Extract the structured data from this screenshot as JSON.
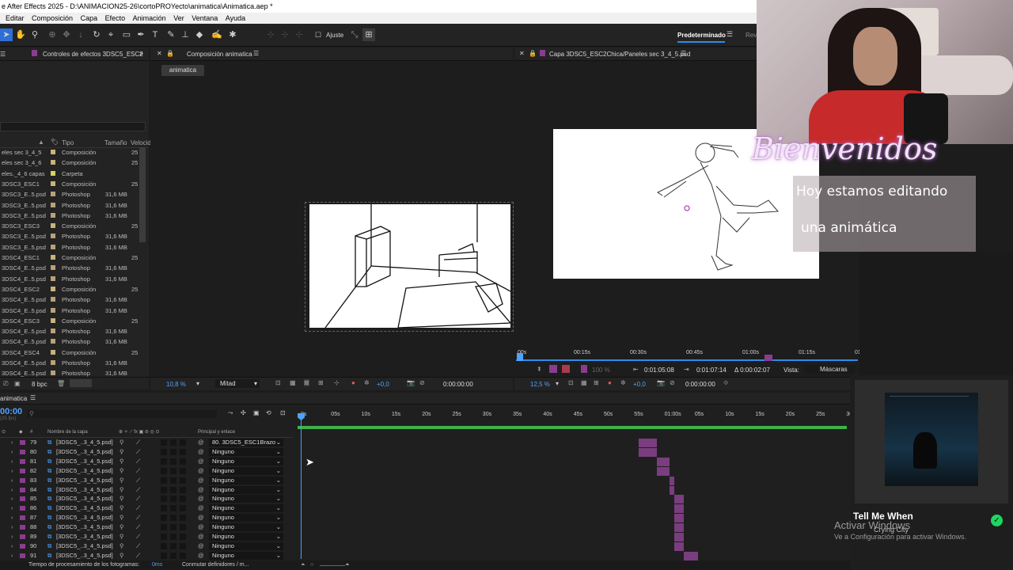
{
  "window": {
    "title": "e After Effects 2025 - D:\\ANIMACION25-26\\cortoPROYecto\\animatica\\Animatica.aep *"
  },
  "menu": [
    "Editar",
    "Composición",
    "Capa",
    "Efecto",
    "Animación",
    "Ver",
    "Ventana",
    "Ayuda"
  ],
  "toolbar": {
    "snap_label": "Ajuste",
    "workspace": "Predeterminado",
    "workspace_next": "Revi"
  },
  "project_panel": {
    "tab_effects": "Controles de efectos 3DSC5_ESC2",
    "columns": {
      "tipo": "Tipo",
      "tamano": "Tamaño",
      "velocidad": "Velocid"
    },
    "bpc": "8 bpc",
    "rows": [
      {
        "name": "eles sec 3_4_5",
        "type": "Composición",
        "size": "",
        "fps": "25",
        "color": "#c9b37a"
      },
      {
        "name": "eles sec 3_4_6",
        "type": "Composición",
        "size": "",
        "fps": "25",
        "color": "#c9b37a"
      },
      {
        "name": "eles._4_6 capas",
        "type": "Carpeta",
        "size": "",
        "fps": "",
        "color": "#d6d35a"
      },
      {
        "name": "3DSC3_ESC1",
        "type": "Composición",
        "size": "",
        "fps": "25",
        "color": "#c9b37a"
      },
      {
        "name": "3DSC3_E..5.psd",
        "type": "Photoshop",
        "size": "31,6 MB",
        "fps": "",
        "color": "#b8a27a"
      },
      {
        "name": "3DSC3_E..5.psd",
        "type": "Photoshop",
        "size": "31,6 MB",
        "fps": "",
        "color": "#b8a27a"
      },
      {
        "name": "3DSC3_E..5.psd",
        "type": "Photoshop",
        "size": "31,6 MB",
        "fps": "",
        "color": "#b8a27a"
      },
      {
        "name": "3DSC3_ESC3",
        "type": "Composición",
        "size": "",
        "fps": "25",
        "color": "#c9b37a"
      },
      {
        "name": "3DSC3_E..5.psd",
        "type": "Photoshop",
        "size": "31,6 MB",
        "fps": "",
        "color": "#b8a27a"
      },
      {
        "name": "3DSC3_E..5.psd",
        "type": "Photoshop",
        "size": "31,6 MB",
        "fps": "",
        "color": "#b8a27a"
      },
      {
        "name": "3DSC4_ESC1",
        "type": "Composición",
        "size": "",
        "fps": "25",
        "color": "#c9b37a"
      },
      {
        "name": "3DSC4_E..5.psd",
        "type": "Photoshop",
        "size": "31,6 MB",
        "fps": "",
        "color": "#b8a27a"
      },
      {
        "name": "3DSC4_E..5.psd",
        "type": "Photoshop",
        "size": "31,6 MB",
        "fps": "",
        "color": "#b8a27a"
      },
      {
        "name": "3DSC4_ESC2",
        "type": "Composición",
        "size": "",
        "fps": "25",
        "color": "#c9b37a"
      },
      {
        "name": "3DSC4_E..5.psd",
        "type": "Photoshop",
        "size": "31,6 MB",
        "fps": "",
        "color": "#b8a27a"
      },
      {
        "name": "3DSC4_E..5.psd",
        "type": "Photoshop",
        "size": "31,6 MB",
        "fps": "",
        "color": "#b8a27a"
      },
      {
        "name": "3DSC4_ESC3",
        "type": "Composición",
        "size": "",
        "fps": "25",
        "color": "#c9b37a"
      },
      {
        "name": "3DSC4_E..5.psd",
        "type": "Photoshop",
        "size": "31,6 MB",
        "fps": "",
        "color": "#b8a27a"
      },
      {
        "name": "3DSC4_E..5.psd",
        "type": "Photoshop",
        "size": "31,6 MB",
        "fps": "",
        "color": "#b8a27a"
      },
      {
        "name": "3DSC4_ESC4",
        "type": "Composición",
        "size": "",
        "fps": "25",
        "color": "#c9b37a"
      },
      {
        "name": "3DSC4_E..5.psd",
        "type": "Photoshop",
        "size": "31,6 MB",
        "fps": "",
        "color": "#b8a27a"
      },
      {
        "name": "3DSC4_E..5.psd",
        "type": "Photoshop",
        "size": "31,6 MB",
        "fps": "",
        "color": "#b8a27a"
      }
    ]
  },
  "comp_panel": {
    "tab": "Composición animatica",
    "subtab": "animatica",
    "zoom": "10,8 %",
    "resolution": "Mitad",
    "exposure": "+0,0",
    "timecode": "0:00:00:00"
  },
  "layer_panel": {
    "tab": "Capa 3DSC5_ESC2Chica/Paneles sec 3_4_5.psd",
    "ruler": [
      "00s",
      "00:15s",
      "00:30s",
      "00:45s",
      "01:00s",
      "01:15s",
      "01:30"
    ],
    "in_time": "0:01:05:08",
    "out_time": "0:01:07:14",
    "duration": "Δ 0:00:02:07",
    "view_label": "Vista:",
    "view_value": "Máscaras",
    "zoom": "12,5 %",
    "zoom_pct": "100 %",
    "exposure": "+0,0",
    "timecode": "0:00:00:00"
  },
  "timeline": {
    "tab": "animatica",
    "timecode": "00:00",
    "fps_hint": "(25 fps)",
    "col_layer_name": "Nombre de la capa",
    "col_parent": "Principal y enlace",
    "col_hash": "#",
    "ruler": [
      "0s",
      "05s",
      "10s",
      "15s",
      "20s",
      "25s",
      "30s",
      "35s",
      "40s",
      "45s",
      "50s",
      "55s",
      "01:00s",
      "05s",
      "10s",
      "15s",
      "20s",
      "25s",
      "30"
    ],
    "layers": [
      {
        "num": "79",
        "name": "[3DSC5_..3_4_5.psd]",
        "parent": "80. 3DSC5_ESC1Brazo",
        "bar_start": 0.621,
        "bar_end": 0.654
      },
      {
        "num": "80",
        "name": "[3DSC5_..3_4_5.psd]",
        "parent": "Ninguno",
        "bar_start": 0.621,
        "bar_end": 0.654
      },
      {
        "num": "81",
        "name": "[3DSC5_..3_4_5.psd]",
        "parent": "Ninguno",
        "bar_start": 0.654,
        "bar_end": 0.677
      },
      {
        "num": "82",
        "name": "[3DSC5_..3_4_5.psd]",
        "parent": "Ninguno",
        "bar_start": 0.654,
        "bar_end": 0.677
      },
      {
        "num": "83",
        "name": "[3DSC5_..3_4_5.psd]",
        "parent": "Ninguno",
        "bar_start": 0.677,
        "bar_end": 0.686
      },
      {
        "num": "84",
        "name": "[3DSC5_..3_4_5.psd]",
        "parent": "Ninguno",
        "bar_start": 0.677,
        "bar_end": 0.686
      },
      {
        "num": "85",
        "name": "[3DSC5_..3_4_5.psd]",
        "parent": "Ninguno",
        "bar_start": 0.686,
        "bar_end": 0.703
      },
      {
        "num": "86",
        "name": "[3DSC5_..3_4_5.psd]",
        "parent": "Ninguno",
        "bar_start": 0.686,
        "bar_end": 0.703
      },
      {
        "num": "87",
        "name": "[3DSC5_..3_4_5.psd]",
        "parent": "Ninguno",
        "bar_start": 0.686,
        "bar_end": 0.703
      },
      {
        "num": "88",
        "name": "[3DSC5_..3_4_5.psd]",
        "parent": "Ninguno",
        "bar_start": 0.686,
        "bar_end": 0.703
      },
      {
        "num": "89",
        "name": "[3DSC5_..3_4_5.psd]",
        "parent": "Ninguno",
        "bar_start": 0.686,
        "bar_end": 0.703
      },
      {
        "num": "90",
        "name": "[3DSC5_..3_4_5.psd]",
        "parent": "Ninguno",
        "bar_start": 0.686,
        "bar_end": 0.703
      },
      {
        "num": "91",
        "name": "[3DSC5_..3_4_5.psd]",
        "parent": "Ninguno",
        "bar_start": 0.703,
        "bar_end": 0.729
      }
    ],
    "status_left": "Tiempo de procesamiento de los fotogramas:",
    "status_ms": "0ms",
    "status_right": "Conmutar definidores / m..."
  },
  "overlay": {
    "welcome": "Bienvenidos",
    "line1": "Hoy estamos editando",
    "line2": "una animática"
  },
  "music": {
    "title": "Tell Me When",
    "artist": "Crying City"
  },
  "watermark": {
    "title": "Activar Windows",
    "subtitle": "Ve a Configuración para activar Windows."
  },
  "colors": {
    "accent_blue": "#2d8ceb",
    "layer_purple": "#8a3c8f",
    "work_area": "#3db24a",
    "track_bar": "#7a3d7f"
  }
}
